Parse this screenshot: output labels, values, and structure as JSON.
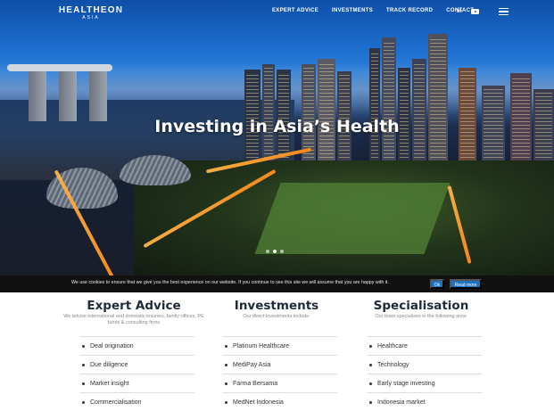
{
  "brand": {
    "name": "HEALTHEON",
    "subtitle": "ASIA"
  },
  "nav": {
    "items": [
      "EXPERT ADVICE",
      "INVESTMENTS",
      "TRACK RECORD",
      "CONTACT"
    ],
    "social": {
      "linkedin": "in",
      "youtube": "youtube-icon"
    },
    "menu_icon": "hamburger-menu-icon"
  },
  "hero": {
    "title": "Investing in Asia’s Health",
    "slides": 3,
    "active_slide": 1
  },
  "cookie": {
    "text": "We use cookies to ensure that we give you the best experience on our website. If you continue to use this site we will assume that you are happy with it.",
    "ok_label": "Ok",
    "more_label": "Read more",
    "button_color": "#1e73be"
  },
  "columns": [
    {
      "title": "Expert Advice",
      "subtitle": "We advise international and domestic insurers, family offices, PE funds & consulting firms",
      "items": [
        "Deal origination",
        "Due diligence",
        "Market insight",
        "Commercialisation"
      ]
    },
    {
      "title": "Investments",
      "subtitle": "Our direct investments include:",
      "items": [
        "Platinum Healthcare",
        "MediPay Asia",
        "Farma Bersama",
        "MedNet Indonesia"
      ]
    },
    {
      "title": "Specialisation",
      "subtitle": "Our team specialises in the following area:",
      "items": [
        "Healthcare",
        "Technology",
        "Early stage investing",
        "Indonesia market"
      ]
    }
  ]
}
